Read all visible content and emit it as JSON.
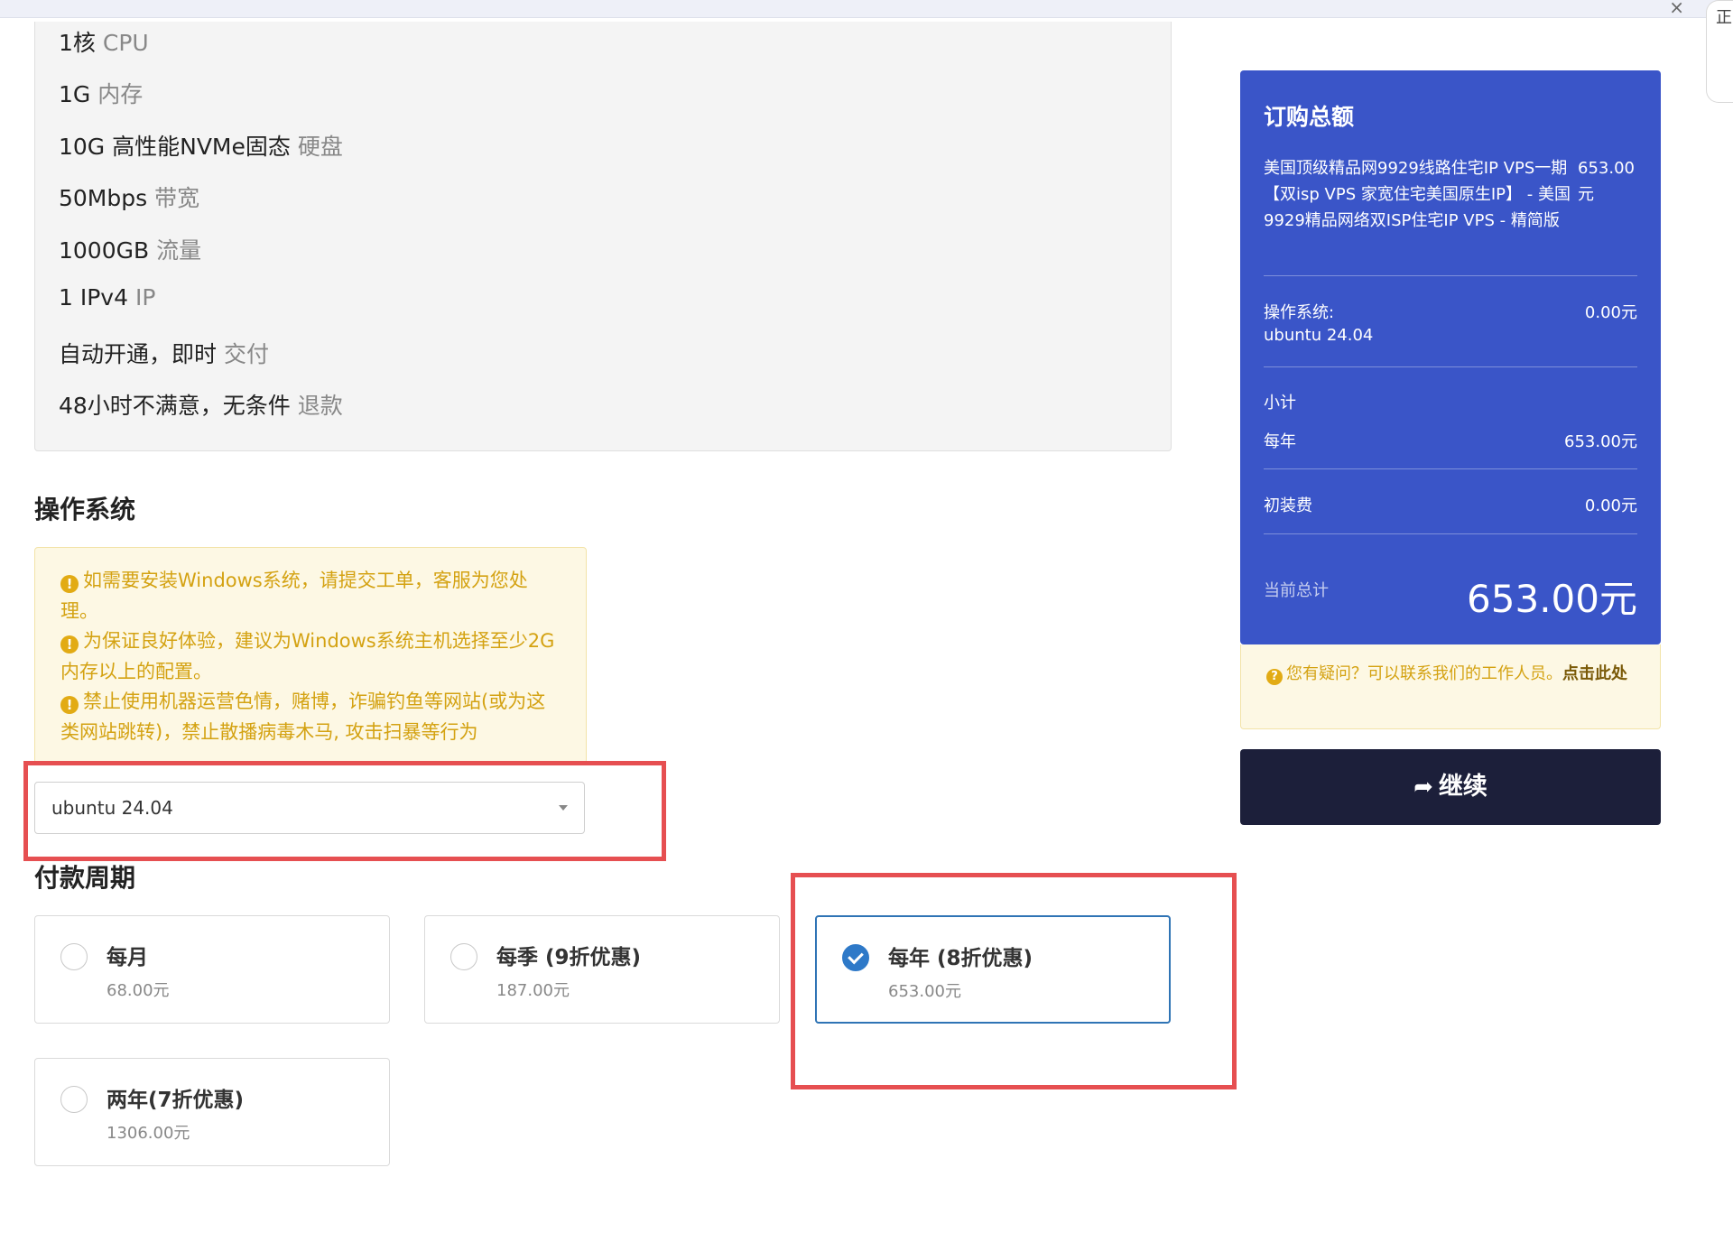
{
  "specs": [
    {
      "value": "1核",
      "unit": "CPU"
    },
    {
      "value": "1G",
      "unit": "内存"
    },
    {
      "value": "10G 高性能NVMe固态",
      "unit": "硬盘"
    },
    {
      "value": "50Mbps",
      "unit": "带宽"
    },
    {
      "value": "1000GB",
      "unit": "流量"
    },
    {
      "value": "1 IPv4",
      "unit": "IP"
    },
    {
      "value": "自动开通，即时",
      "unit": "交付"
    },
    {
      "value": "48小时不满意，无条件",
      "unit": "退款"
    }
  ],
  "os_section": {
    "title": "操作系统",
    "warnings": [
      "如需要安装Windows系统，请提交工单，客服为您处理。",
      "为保证良好体验，建议为Windows系统主机选择至少2G内存以上的配置。",
      "禁止使用机器运营色情，赌博，诈骗钓鱼等网站(或为这类网站跳转)，禁止散播病毒木马, 攻击扫暴等行为"
    ],
    "selected_os": "ubuntu 24.04"
  },
  "billing": {
    "title": "付款周期",
    "options": [
      {
        "name": "每月",
        "price": "68.00元",
        "selected": false
      },
      {
        "name": "每季 (9折优惠)",
        "price": "187.00元",
        "selected": false
      },
      {
        "name": "每年 (8折优惠)",
        "price": "653.00元",
        "selected": true
      },
      {
        "name": "两年(7折优惠)",
        "price": "1306.00元",
        "selected": false
      }
    ]
  },
  "summary": {
    "title": "订购总额",
    "product": "美国顶级精品网9929线路住宅IP VPS一期【双isp VPS 家宽住宅美国原生IP】 - 美国9929精品网络双ISP住宅IP VPS - 精简版",
    "product_price": "653.00元",
    "os_label": "操作系统:",
    "os_value": "ubuntu 24.04",
    "os_price": "0.00元",
    "subtotal_label": "小计",
    "cycle_label": "每年",
    "cycle_price": "653.00元",
    "setup_label": "初装费",
    "setup_price": "0.00元",
    "total_label": "当前总计",
    "total": "653.00元"
  },
  "help": {
    "text": "您有疑问？可以联系我们的工作人员。",
    "link": "点击此处"
  },
  "continue_label": "继续",
  "partial_text": {
    "edge": "正"
  },
  "colors": {
    "summary_bg": "#3a55c8",
    "warning_text": "#d4a212",
    "continue_bg": "#1c1f3a",
    "highlight": "#e64f51"
  }
}
